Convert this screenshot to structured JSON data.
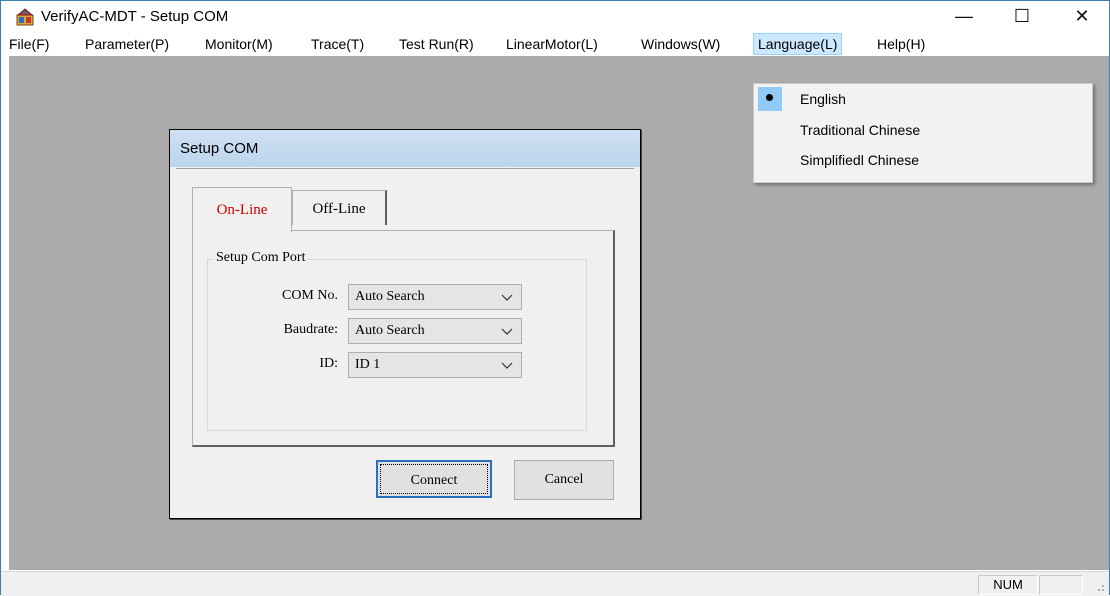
{
  "window": {
    "title": "VerifyAC-MDT - Setup COM",
    "controls": {
      "minimize": "—",
      "maximize": "☐",
      "close": "✕"
    }
  },
  "menubar": {
    "items": [
      {
        "label": "File(F)"
      },
      {
        "label": "Parameter(P)"
      },
      {
        "label": "Monitor(M)"
      },
      {
        "label": "Trace(T)"
      },
      {
        "label": "Test Run(R)"
      },
      {
        "label": "LinearMotor(L)"
      },
      {
        "label": "Windows(W)"
      },
      {
        "label": "Language(L)"
      },
      {
        "label": "Help(H)"
      }
    ]
  },
  "language_menu": {
    "items": [
      {
        "label": "English",
        "checked": true
      },
      {
        "label": "Traditional Chinese",
        "checked": false
      },
      {
        "label": "Simplifiedl Chinese",
        "checked": false
      }
    ]
  },
  "dialog": {
    "title": "Setup COM",
    "tabs": [
      {
        "label": "On-Line",
        "active": true
      },
      {
        "label": "Off-Line",
        "active": false
      }
    ],
    "group_label": "Setup Com Port",
    "fields": [
      {
        "label": "COM No.",
        "value": "Auto Search"
      },
      {
        "label": "Baudrate:",
        "value": "Auto Search"
      },
      {
        "label": "ID:",
        "value": "ID 1"
      }
    ],
    "connect_label": "Connect",
    "cancel_label": "Cancel"
  },
  "statusbar": {
    "num": "NUM"
  },
  "colors": {
    "client_bg": "#ababab",
    "menu_highlight": "#cce8ff",
    "active_tab_text": "#cc0000"
  }
}
